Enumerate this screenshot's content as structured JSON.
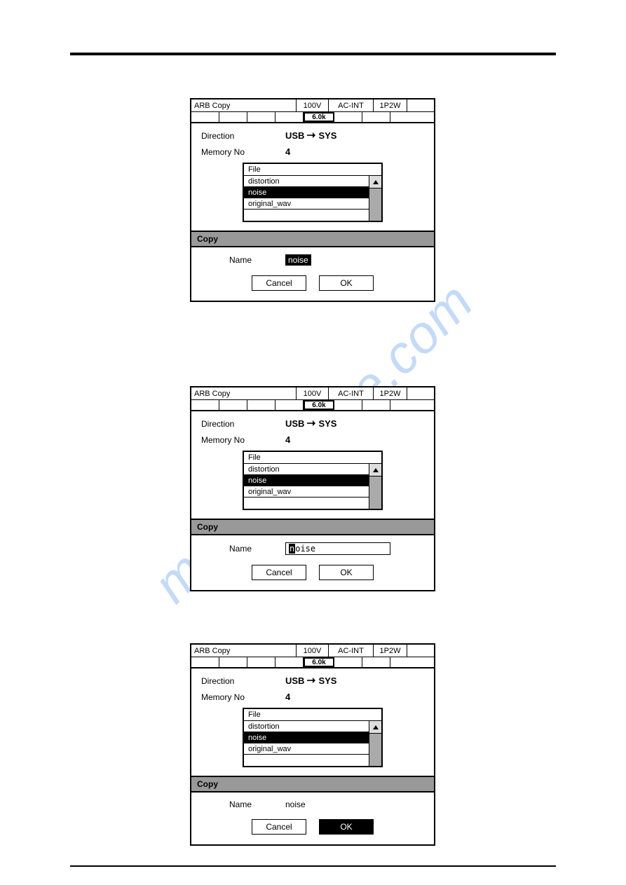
{
  "watermark": "manualshive.com",
  "header": {
    "title": "ARB Copy",
    "voltage": "100V",
    "mode": "AC-INT",
    "wiring": "1P2W"
  },
  "status": {
    "freq": "6.0k"
  },
  "params": {
    "direction_label": "Direction",
    "direction_from": "USB",
    "direction_to": "SYS",
    "memory_label": "Memory No",
    "memory_value": "4"
  },
  "filebox": {
    "header": "File",
    "items": [
      "distortion",
      "noise",
      "original_wav"
    ],
    "selected": "noise"
  },
  "copy": {
    "title": "Copy",
    "name_label": "Name",
    "buttons": {
      "cancel": "Cancel",
      "ok": "OK"
    }
  },
  "panels": [
    {
      "name_style": "inverted",
      "name_value": "noise",
      "ok_selected": false
    },
    {
      "name_style": "editbox",
      "name_cursor": "n",
      "name_rest": "oise",
      "ok_selected": false
    },
    {
      "name_style": "plain",
      "name_value": "noise",
      "ok_selected": true
    }
  ]
}
